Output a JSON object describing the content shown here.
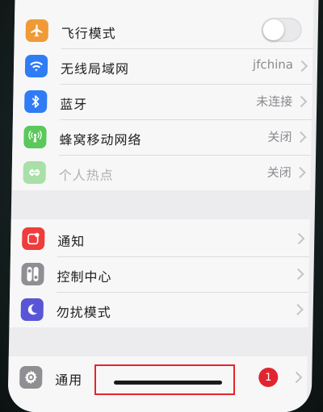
{
  "settings": {
    "connectivity": [
      {
        "label": "飞行模式",
        "icon": "airplane-icon",
        "color": "#f09a37",
        "control": "toggle",
        "toggle_on": false
      },
      {
        "label": "无线局域网",
        "icon": "wifi-icon",
        "color": "#2f7cf6",
        "value": "jfchina"
      },
      {
        "label": "蓝牙",
        "icon": "bluetooth-icon",
        "color": "#2f7cf6",
        "value": "未连接"
      },
      {
        "label": "蜂窝移动网络",
        "icon": "cellular-icon",
        "color": "#5ac85a",
        "value": "关闭"
      },
      {
        "label": "个人热点",
        "icon": "hotspot-icon",
        "color": "#a8e0a8",
        "value": "关闭",
        "disabled": true
      }
    ],
    "system": [
      {
        "label": "通知",
        "icon": "notifications-icon",
        "color": "#ef3c3c"
      },
      {
        "label": "控制中心",
        "icon": "control-center-icon",
        "color": "#8e8e93"
      },
      {
        "label": "勿扰模式",
        "icon": "moon-icon",
        "color": "#5856d6"
      }
    ],
    "general": [
      {
        "label": "通用",
        "icon": "gear-icon",
        "color": "#8e8e93",
        "badge": "1"
      }
    ]
  },
  "colors": {
    "highlight": "#e4262c",
    "badge": "#e0252e"
  }
}
